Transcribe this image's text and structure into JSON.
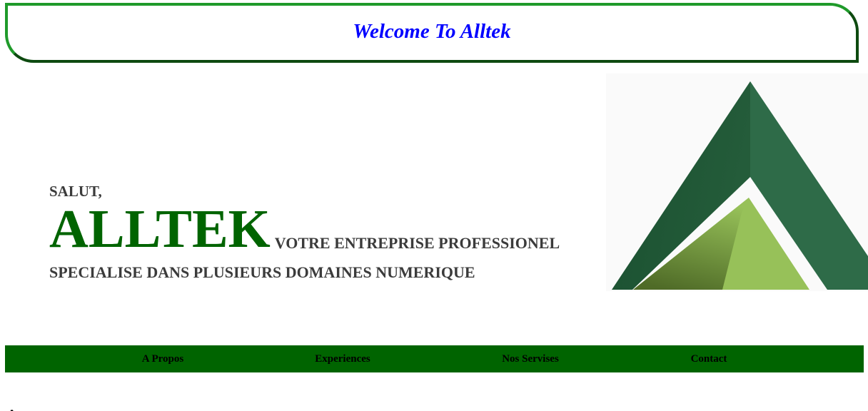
{
  "header": {
    "title": "Welcome To Alltek",
    "title_color": "#0000ff",
    "border_color_light": "#1f9a2a",
    "border_color_dark": "#0d4a10"
  },
  "hero": {
    "greeting": "SALUT,",
    "brand": "ALLTEK",
    "brand_color": "#006400",
    "tagline": "VOTRE ENTREPRISE PROFESSIONEL",
    "subtitle": "SPECIALISE DANS PLUSIEURS DOMAINES NUMERIQUE",
    "logo_icon": "alltek-triangle-logo-icon",
    "logo_colors": [
      "#1e5c38",
      "#2e6b48",
      "#97c159",
      "#5a7a2e"
    ]
  },
  "nav": {
    "background": "#006400",
    "items": [
      {
        "label": "A Propos"
      },
      {
        "label": "Experiences"
      },
      {
        "label": "Nos Servises"
      },
      {
        "label": "Contact"
      }
    ]
  }
}
